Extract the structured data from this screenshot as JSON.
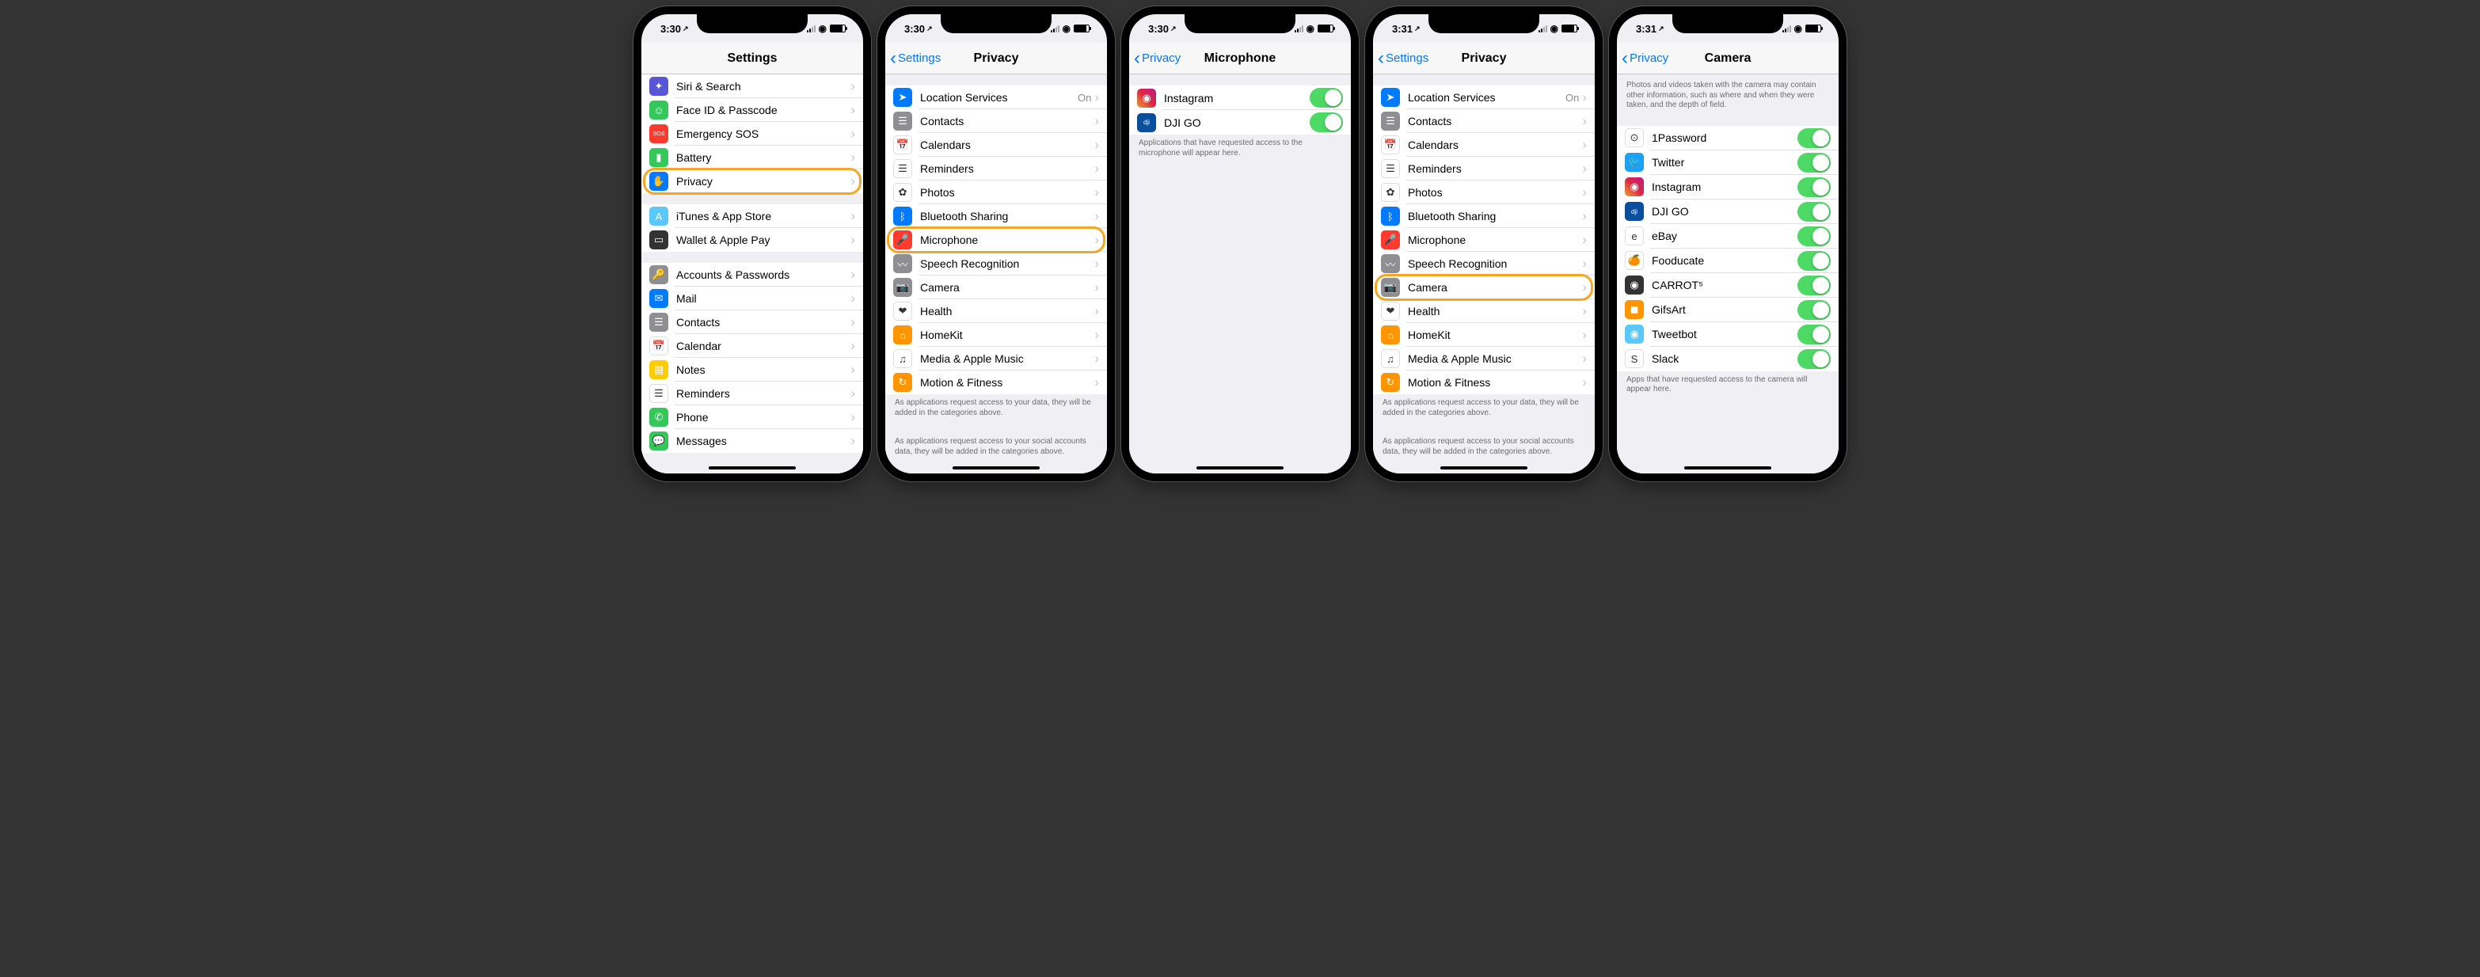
{
  "status": {
    "signal": "••",
    "wifi": "wifi",
    "battery": "85%"
  },
  "phones": [
    {
      "time": "3:30",
      "title": "Settings",
      "back": null,
      "highlight": "privacy",
      "footers": [],
      "groups": [
        {
          "items": [
            {
              "key": "siri",
              "icon": "siri-icon",
              "label": "Siri & Search",
              "bg": "bg-purple",
              "glyph": "✦"
            },
            {
              "key": "faceid",
              "icon": "faceid-icon",
              "label": "Face ID & Passcode",
              "bg": "bg-green",
              "glyph": "☺"
            },
            {
              "key": "sos",
              "icon": "sos-icon",
              "label": "Emergency SOS",
              "bg": "bg-red",
              "glyph": "SOS",
              "fs": "7px"
            },
            {
              "key": "battery",
              "icon": "battery-icon",
              "label": "Battery",
              "bg": "bg-green",
              "glyph": "▮"
            },
            {
              "key": "privacy",
              "icon": "privacy-icon",
              "label": "Privacy",
              "bg": "bg-blue",
              "glyph": "✋"
            }
          ]
        },
        {
          "items": [
            {
              "key": "itunes",
              "icon": "itunes-icon",
              "label": "iTunes & App Store",
              "bg": "bg-teal",
              "glyph": "A"
            },
            {
              "key": "wallet",
              "icon": "wallet-icon",
              "label": "Wallet & Apple Pay",
              "bg": "bg-dark",
              "glyph": "▭"
            }
          ]
        },
        {
          "items": [
            {
              "key": "accounts",
              "icon": "accounts-icon",
              "label": "Accounts & Passwords",
              "bg": "bg-gray",
              "glyph": "🔑"
            },
            {
              "key": "mail",
              "icon": "mail-icon",
              "label": "Mail",
              "bg": "bg-blue",
              "glyph": "✉"
            },
            {
              "key": "contacts",
              "icon": "contacts-icon",
              "label": "Contacts",
              "bg": "bg-gray",
              "glyph": "☰"
            },
            {
              "key": "calendar",
              "icon": "calendar-icon",
              "label": "Calendar",
              "bg": "bg-white",
              "glyph": "📅"
            },
            {
              "key": "notes",
              "icon": "notes-icon",
              "label": "Notes",
              "bg": "bg-yellow",
              "glyph": "▤"
            },
            {
              "key": "reminders",
              "icon": "reminders-icon",
              "label": "Reminders",
              "bg": "bg-white",
              "glyph": "☰"
            },
            {
              "key": "phone",
              "icon": "phone-icon",
              "label": "Phone",
              "bg": "bg-green",
              "glyph": "✆"
            },
            {
              "key": "messages",
              "icon": "messages-icon",
              "label": "Messages",
              "bg": "bg-green",
              "glyph": "💬"
            }
          ]
        }
      ]
    },
    {
      "time": "3:30",
      "title": "Privacy",
      "back": "Settings",
      "highlight": "microphone",
      "footers": [
        "As applications request access to your data, they will be added in the categories above.",
        "As applications request access to your social accounts data, they will be added in the categories above."
      ],
      "groups": [
        {
          "items": [
            {
              "key": "location",
              "icon": "location-icon",
              "label": "Location Services",
              "bg": "bg-blue",
              "glyph": "➤",
              "value": "On"
            },
            {
              "key": "contacts2",
              "icon": "contacts2-icon",
              "label": "Contacts",
              "bg": "bg-gray",
              "glyph": "☰"
            },
            {
              "key": "calendars2",
              "icon": "calendars2-icon",
              "label": "Calendars",
              "bg": "bg-white",
              "glyph": "📅"
            },
            {
              "key": "reminders2",
              "icon": "reminders2-icon",
              "label": "Reminders",
              "bg": "bg-white",
              "glyph": "☰"
            },
            {
              "key": "photos",
              "icon": "photos-icon",
              "label": "Photos",
              "bg": "bg-white",
              "glyph": "✿"
            },
            {
              "key": "bluetooth",
              "icon": "bluetooth-icon",
              "label": "Bluetooth Sharing",
              "bg": "bg-blue",
              "glyph": "ᛒ"
            },
            {
              "key": "microphone",
              "icon": "microphone-icon",
              "label": "Microphone",
              "bg": "bg-red",
              "glyph": "🎤"
            },
            {
              "key": "speech",
              "icon": "speech-icon",
              "label": "Speech Recognition",
              "bg": "bg-gray",
              "glyph": "〰"
            },
            {
              "key": "camera",
              "icon": "camera-icon",
              "label": "Camera",
              "bg": "bg-gray",
              "glyph": "📷"
            },
            {
              "key": "health",
              "icon": "health-icon",
              "label": "Health",
              "bg": "bg-white",
              "glyph": "❤"
            },
            {
              "key": "homekit",
              "icon": "homekit-icon",
              "label": "HomeKit",
              "bg": "bg-orange",
              "glyph": "⌂"
            },
            {
              "key": "media",
              "icon": "media-icon",
              "label": "Media & Apple Music",
              "bg": "bg-white",
              "glyph": "♫"
            },
            {
              "key": "motion",
              "icon": "motion-icon",
              "label": "Motion & Fitness",
              "bg": "bg-orange",
              "glyph": "↻"
            }
          ]
        }
      ]
    },
    {
      "time": "3:30",
      "title": "Microphone",
      "back": "Privacy",
      "highlight": null,
      "footers": [
        "Applications that have requested access to the microphone will appear here."
      ],
      "groups": [
        {
          "items": [
            {
              "key": "instagram",
              "icon": "instagram-icon",
              "label": "Instagram",
              "bg": "gradient-ig",
              "glyph": "◉",
              "toggle": true
            },
            {
              "key": "djigo",
              "icon": "djigo-icon",
              "label": "DJI GO",
              "bg": "bg-dji",
              "glyph": "dji",
              "fs": "8px",
              "toggle": true
            }
          ]
        }
      ]
    },
    {
      "time": "3:31",
      "title": "Privacy",
      "back": "Settings",
      "highlight": "camera",
      "footers": [
        "As applications request access to your data, they will be added in the categories above.",
        "As applications request access to your social accounts data, they will be added in the categories above."
      ],
      "groups": [
        {
          "items": [
            {
              "key": "location",
              "icon": "location-icon",
              "label": "Location Services",
              "bg": "bg-blue",
              "glyph": "➤",
              "value": "On"
            },
            {
              "key": "contacts2",
              "icon": "contacts2-icon",
              "label": "Contacts",
              "bg": "bg-gray",
              "glyph": "☰"
            },
            {
              "key": "calendars2",
              "icon": "calendars2-icon",
              "label": "Calendars",
              "bg": "bg-white",
              "glyph": "📅"
            },
            {
              "key": "reminders2",
              "icon": "reminders2-icon",
              "label": "Reminders",
              "bg": "bg-white",
              "glyph": "☰"
            },
            {
              "key": "photos",
              "icon": "photos-icon",
              "label": "Photos",
              "bg": "bg-white",
              "glyph": "✿"
            },
            {
              "key": "bluetooth",
              "icon": "bluetooth-icon",
              "label": "Bluetooth Sharing",
              "bg": "bg-blue",
              "glyph": "ᛒ"
            },
            {
              "key": "microphone",
              "icon": "microphone-icon",
              "label": "Microphone",
              "bg": "bg-red",
              "glyph": "🎤"
            },
            {
              "key": "speech",
              "icon": "speech-icon",
              "label": "Speech Recognition",
              "bg": "bg-gray",
              "glyph": "〰"
            },
            {
              "key": "camera",
              "icon": "camera-icon",
              "label": "Camera",
              "bg": "bg-gray",
              "glyph": "📷"
            },
            {
              "key": "health",
              "icon": "health-icon",
              "label": "Health",
              "bg": "bg-white",
              "glyph": "❤"
            },
            {
              "key": "homekit",
              "icon": "homekit-icon",
              "label": "HomeKit",
              "bg": "bg-orange",
              "glyph": "⌂"
            },
            {
              "key": "media",
              "icon": "media-icon",
              "label": "Media & Apple Music",
              "bg": "bg-white",
              "glyph": "♫"
            },
            {
              "key": "motion",
              "icon": "motion-icon",
              "label": "Motion & Fitness",
              "bg": "bg-orange",
              "glyph": "↻"
            }
          ]
        }
      ]
    },
    {
      "time": "3:31",
      "title": "Camera",
      "back": "Privacy",
      "highlight": null,
      "header": "Photos and videos taken with the camera may contain other information, such as where and when they were taken, and the depth of field.",
      "footers": [
        "Apps that have requested access to the camera will appear here."
      ],
      "groups": [
        {
          "items": [
            {
              "key": "1password",
              "icon": "1password-icon",
              "label": "1Password",
              "bg": "bg-white",
              "glyph": "⊙",
              "toggle": true
            },
            {
              "key": "twitter",
              "icon": "twitter-icon",
              "label": "Twitter",
              "bg": "bg-tw",
              "glyph": "🐦",
              "toggle": true
            },
            {
              "key": "instagram2",
              "icon": "instagram-icon",
              "label": "Instagram",
              "bg": "gradient-ig",
              "glyph": "◉",
              "toggle": true
            },
            {
              "key": "djigo2",
              "icon": "djigo-icon",
              "label": "DJI GO",
              "bg": "bg-dji",
              "glyph": "dji",
              "fs": "8px",
              "toggle": true
            },
            {
              "key": "ebay",
              "icon": "ebay-icon",
              "label": "eBay",
              "bg": "bg-white",
              "glyph": "e",
              "toggle": true
            },
            {
              "key": "fooducate",
              "icon": "fooducate-icon",
              "label": "Fooducate",
              "bg": "bg-white",
              "glyph": "🍊",
              "toggle": true
            },
            {
              "key": "carrot",
              "icon": "carrot-icon",
              "label": "CARROT⁵",
              "bg": "bg-dark",
              "glyph": "◉",
              "toggle": true
            },
            {
              "key": "gifsart",
              "icon": "gifsart-icon",
              "label": "GifsArt",
              "bg": "bg-orange",
              "glyph": "◼",
              "toggle": true
            },
            {
              "key": "tweetbot",
              "icon": "tweetbot-icon",
              "label": "Tweetbot",
              "bg": "bg-teal",
              "glyph": "◉",
              "toggle": true
            },
            {
              "key": "slack",
              "icon": "slack-icon",
              "label": "Slack",
              "bg": "bg-white",
              "glyph": "S",
              "toggle": true
            }
          ]
        }
      ]
    }
  ]
}
